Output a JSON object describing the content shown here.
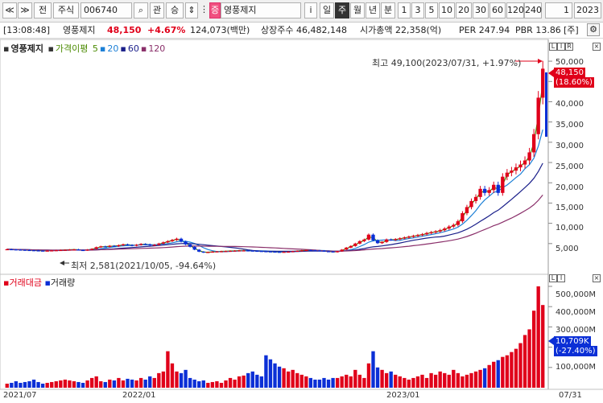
{
  "toolbar": {
    "nav": [
      "≪",
      "≫"
    ],
    "jeon": "전",
    "type": "주식",
    "code": "006740",
    "search_icon": "⌕",
    "gwan": "관",
    "updown": "승",
    "stock_badge": "증",
    "stock_name": "영풍제지",
    "info_btn": "i",
    "periods": [
      "일",
      "주",
      "월",
      "년",
      "분"
    ],
    "selected_period": "주",
    "minutes": [
      "1",
      "3",
      "5",
      "10",
      "20",
      "30",
      "60",
      "120",
      "240"
    ],
    "count": "1",
    "date": "2023"
  },
  "info": {
    "time": "[13:08:48]",
    "name": "영풍제지",
    "price": "48,150",
    "change": "+4.67%",
    "amount": "124,073(백만)",
    "shares": "상장주수 46,482,148",
    "mktcap": "시가총액 22,358(억)",
    "per": "PER 247.94",
    "pbr": "PBR 13.86",
    "board": "[주]"
  },
  "legend": {
    "name": "영풍제지",
    "ma_label": "가격이평",
    "ma": [
      "5",
      "20",
      "60",
      "120"
    ],
    "colors": {
      "ma5": "#4a8a00",
      "ma20": "#1b7fd6",
      "ma60": "#1a1f8a",
      "ma120": "#8a2f6a",
      "up": "#e0001a",
      "down": "#0b2fd6"
    }
  },
  "annotations": {
    "high": "최고 49,100(2023/07/31, +1.97%)",
    "low": "최저 2,581(2021/10/05, -94.64%)",
    "price_tag": "48,150",
    "price_pct": "(18.60%)",
    "vol_tag": "10,709K",
    "vol_pct": "(-27.40%)"
  },
  "price_axis": [
    "50,000",
    "45,000",
    "40,000",
    "35,000",
    "30,000",
    "25,000",
    "20,000",
    "15,000",
    "10,000",
    "5,000"
  ],
  "volume_axis": [
    "500,000M",
    "400,000M",
    "300,000M",
    "200,000M",
    "100,000M"
  ],
  "xaxis": [
    "2021/07",
    "2022/01",
    "2023/01",
    "07/31"
  ],
  "volume_legend": [
    "거래대금",
    "거래량"
  ],
  "chart_data": {
    "type": "candlestick",
    "title": "영풍제지",
    "price_high": 49100,
    "price_low": 2581,
    "last": 48150,
    "closes": [
      3600,
      3550,
      3500,
      3450,
      3400,
      3350,
      3300,
      3250,
      3200,
      3250,
      3300,
      3350,
      3400,
      3450,
      3500,
      3550,
      3400,
      3350,
      3500,
      3700,
      4100,
      4300,
      4200,
      4450,
      4350,
      4600,
      4800,
      4650,
      4500,
      4700,
      4900,
      4800,
      4600,
      4700,
      5000,
      5300,
      5600,
      5900,
      6200,
      5500,
      4800,
      4200,
      3500,
      3000,
      2800,
      2900,
      3000,
      3050,
      3100,
      3150,
      3200,
      3250,
      3300,
      3300,
      3250,
      3200,
      3150,
      3100,
      3050,
      3000,
      2950,
      2900,
      2950,
      3000,
      3100,
      3200,
      3300,
      3400,
      3350,
      3300,
      3250,
      3100,
      3050,
      2900,
      3100,
      3500,
      4000,
      4400,
      5000,
      5600,
      6000,
      7200,
      5800,
      5100,
      5400,
      6000,
      5900,
      6100,
      6300,
      6500,
      6700,
      6900,
      7100,
      7300,
      7600,
      7800,
      8000,
      8300,
      8700,
      9200,
      9600,
      10500,
      12500,
      14000,
      15500,
      16500,
      18500,
      17500,
      18200,
      19500,
      17500,
      21500,
      22500,
      23000,
      23800,
      24500,
      25500,
      27500,
      32000,
      41000,
      48150
    ],
    "volumes": [
      5,
      6,
      8,
      6,
      7,
      8,
      10,
      7,
      5,
      6,
      7,
      8,
      9,
      10,
      9,
      8,
      7,
      6,
      9,
      12,
      14,
      8,
      7,
      10,
      9,
      12,
      9,
      11,
      10,
      9,
      12,
      10,
      14,
      12,
      18,
      20,
      45,
      30,
      20,
      18,
      22,
      12,
      10,
      8,
      9,
      6,
      7,
      8,
      6,
      9,
      12,
      10,
      14,
      15,
      18,
      20,
      16,
      14,
      40,
      35,
      30,
      26,
      24,
      20,
      22,
      18,
      16,
      14,
      12,
      10,
      10,
      12,
      10,
      12,
      12,
      14,
      16,
      14,
      22,
      16,
      12,
      30,
      45,
      25,
      22,
      18,
      20,
      16,
      14,
      12,
      10,
      12,
      14,
      16,
      12,
      18,
      16,
      20,
      18,
      16,
      22,
      18,
      14,
      16,
      18,
      20,
      22,
      24,
      28,
      32,
      34,
      38,
      40,
      44,
      48,
      55,
      65,
      72,
      95,
      125,
      102
    ],
    "series": [
      {
        "name": "거래대금"
      },
      {
        "name": "거래량"
      }
    ]
  }
}
